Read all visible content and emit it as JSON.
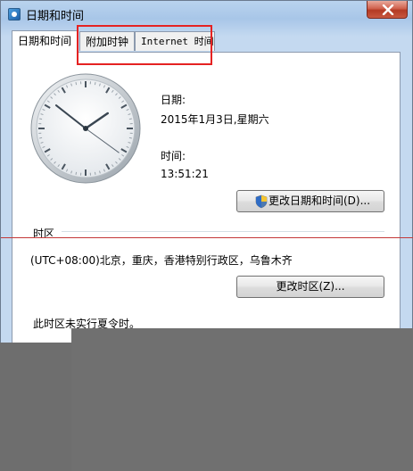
{
  "window": {
    "title": "日期和时间"
  },
  "tabs": [
    {
      "label": "日期和时间",
      "active": true
    },
    {
      "label": "附加时钟",
      "active": false
    },
    {
      "label": "Internet 时间",
      "active": false
    }
  ],
  "date": {
    "label": "日期:",
    "value": "2015年1月3日,星期六"
  },
  "time": {
    "label": "时间:",
    "value": "13:51:21"
  },
  "clock": {
    "hour": 13,
    "minute": 51,
    "second": 21
  },
  "buttons": {
    "change_datetime": "更改日期和时间(D)...",
    "change_timezone": "更改时区(Z)..."
  },
  "timezone": {
    "group_label": "时区",
    "value": "(UTC+08:00)北京，重庆，香港特别行政区，乌鲁木齐",
    "dst_note": "此时区未实行夏令时。"
  },
  "icons": {
    "app": "clock-app-icon",
    "close": "close-icon",
    "shield": "uac-shield-icon"
  },
  "colors": {
    "highlight": "#e52222",
    "titlebar": "#b9d3ee",
    "overlay": "#707070"
  }
}
